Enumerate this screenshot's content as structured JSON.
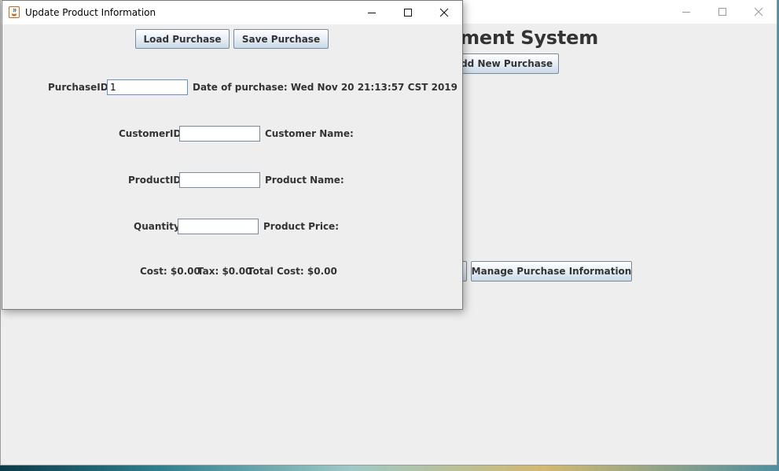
{
  "background_window": {
    "heading": "ement System",
    "buttons": {
      "add_new_purchase": "Add New Purchase",
      "manage_purchase_information": "Manage Purchase Information"
    }
  },
  "dialog": {
    "title": "Update Product Information",
    "toolbar": {
      "load_purchase": "Load Purchase",
      "save_purchase": "Save Purchase"
    },
    "fields": {
      "purchase_id": {
        "label": "PurchaseID",
        "value": "1"
      },
      "date_of_purchase": "Date of purchase: Wed Nov 20 21:13:57 CST 2019",
      "customer_id": {
        "label": "CustomerID",
        "value": ""
      },
      "customer_name": "Customer Name:",
      "product_id": {
        "label": "ProductID",
        "value": ""
      },
      "product_name": "Product Name:",
      "quantity": {
        "label": "Quantity",
        "value": ""
      },
      "product_price": "Product Price:"
    },
    "summary": {
      "cost": "Cost: $0.00",
      "tax": "Tax: $0.00",
      "total_cost": "Total Cost: $0.00"
    }
  },
  "icons": {
    "app": "java-coffee-cup-icon",
    "minimize": "minimize-icon",
    "maximize": "maximize-icon",
    "close": "close-icon"
  },
  "colors": {
    "window_background": "#eeeeee",
    "button_gradient_bottom": "#c9d9e8",
    "text": "#333333"
  }
}
